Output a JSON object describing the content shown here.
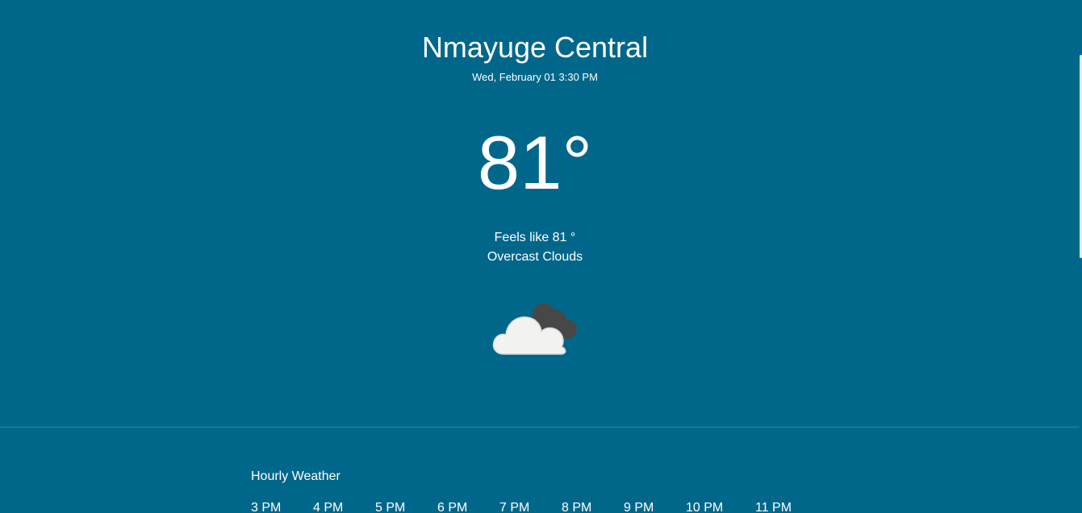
{
  "location": {
    "city": "Nmayuge Central",
    "datetime": "Wed, February 01 3:30 PM"
  },
  "current": {
    "temperature": "81°",
    "feels_like": "Feels like 81 °",
    "condition": "Overcast Clouds",
    "icon": "overcast-clouds-icon"
  },
  "hourly": {
    "title": "Hourly Weather",
    "hours": [
      "3 PM",
      "4 PM",
      "5 PM",
      "6 PM",
      "7 PM",
      "8 PM",
      "9 PM",
      "10 PM",
      "11 PM"
    ]
  },
  "colors": {
    "background": "#00678b",
    "text": "#ffffff",
    "cloud_front": "#f2f2f0",
    "cloud_back": "#474747"
  }
}
